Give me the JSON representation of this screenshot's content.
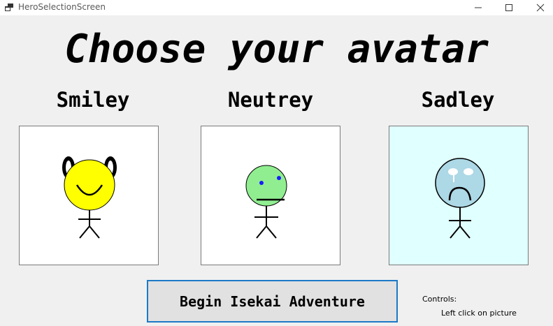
{
  "window": {
    "title": "HeroSelectionScreen",
    "icon": "app-window-icon",
    "controls": [
      "minimize-icon",
      "maximize-icon",
      "close-icon"
    ]
  },
  "heading": "Choose your avatar",
  "avatars": [
    {
      "name": "Smiley",
      "face_color": "#ffff00",
      "card_color": "#ffffff",
      "icon": "smiley-avatar-icon"
    },
    {
      "name": "Neutrey",
      "face_color": "#90ee90",
      "card_color": "#ffffff",
      "icon": "neutral-avatar-icon"
    },
    {
      "name": "Sadley",
      "face_color": "#add8e6",
      "card_color": "#e0ffff",
      "icon": "sad-avatar-icon"
    }
  ],
  "begin_button": "Begin Isekai Adventure",
  "controls": {
    "label": "Controls:",
    "text": "Left click on picture"
  },
  "colors": {
    "background": "#f0f0f0",
    "button_border": "#1c79c7",
    "button_fill": "#e1e1e1"
  }
}
